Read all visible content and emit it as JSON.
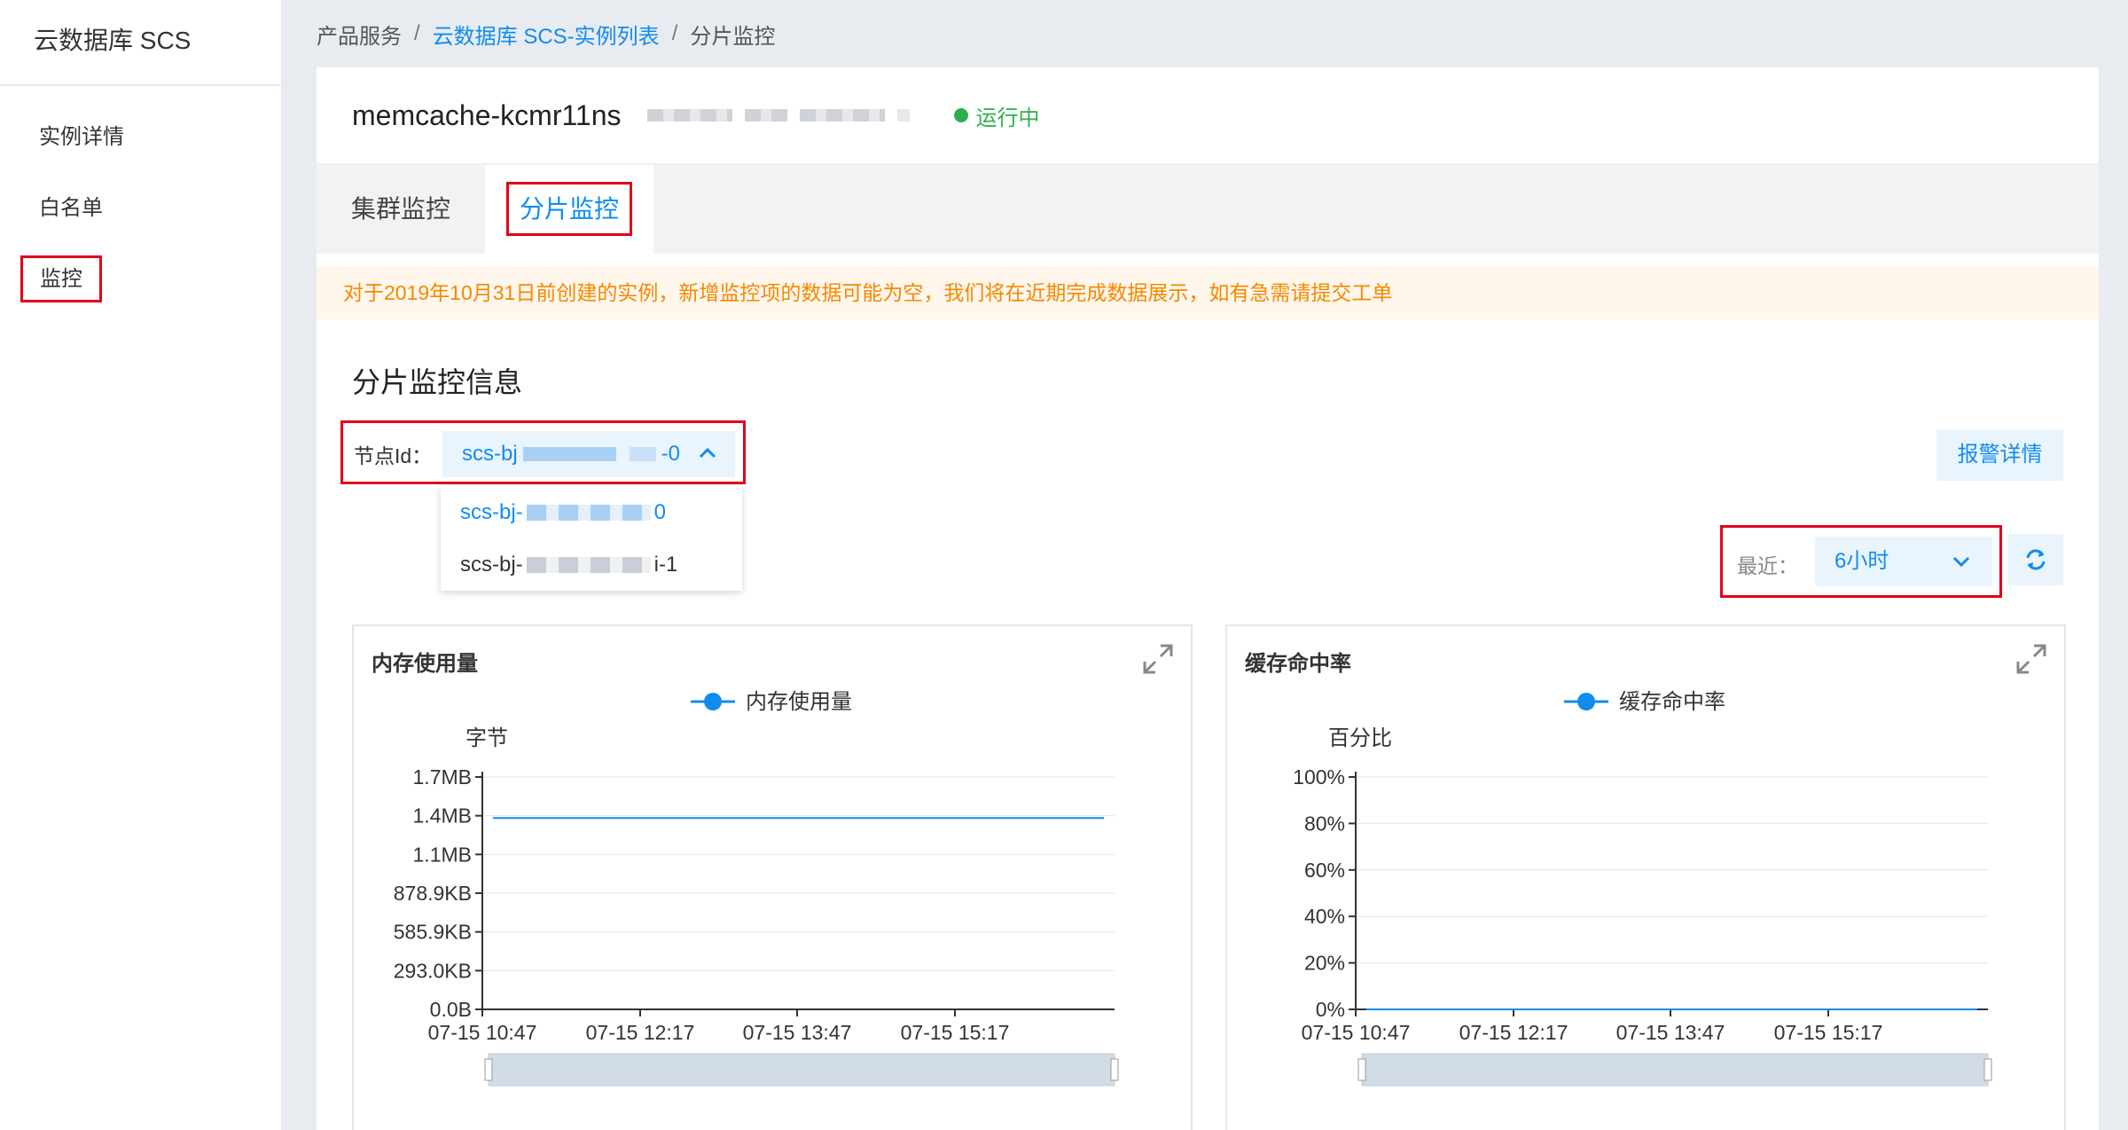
{
  "sidebar": {
    "title": "云数据库 SCS",
    "items": [
      {
        "label": "实例详情"
      },
      {
        "label": "白名单"
      },
      {
        "label": "监控"
      }
    ]
  },
  "breadcrumb": {
    "root": "产品服务",
    "link": "云数据库 SCS-实例列表",
    "current": "分片监控",
    "sep": "/"
  },
  "instance": {
    "name": "memcache-kcmr11ns",
    "status": "运行中"
  },
  "tabs": [
    {
      "label": "集群监控"
    },
    {
      "label": "分片监控"
    }
  ],
  "notice": "对于2019年10月31日前创建的实例，新增监控项的数据可能为空，我们将在近期完成数据展示，如有急需请提交工单",
  "section_title": "分片监控信息",
  "node": {
    "label": "节点Id：",
    "selected_prefix": "scs-bj",
    "selected_suffix": "-0",
    "options": [
      {
        "prefix": "scs-bj-",
        "suffix": "0"
      },
      {
        "prefix": "scs-bj-",
        "suffix": "i-1"
      }
    ]
  },
  "alarm_button": "报警详情",
  "recent": {
    "label": "最近：",
    "value": "6小时"
  },
  "colors": {
    "accent": "#108cee",
    "highlight": "#e0001b",
    "success": "#2cb04f",
    "warning": "#f38900"
  },
  "chart_data": [
    {
      "type": "line",
      "title": "内存使用量",
      "legend": "内存使用量",
      "unit_label": "字节",
      "yticks": [
        "0.0B",
        "293.0KB",
        "585.9KB",
        "878.9KB",
        "1.1MB",
        "1.4MB",
        "1.7MB"
      ],
      "ylim": [
        0,
        1.7
      ],
      "xticks": [
        "07-15 10:47",
        "07-15 12:17",
        "07-15 13:47",
        "07-15 15:17"
      ],
      "series": [
        {
          "name": "内存使用量",
          "values": [
            1.4,
            1.4
          ]
        }
      ]
    },
    {
      "type": "line",
      "title": "缓存命中率",
      "legend": "缓存命中率",
      "unit_label": "百分比",
      "yticks": [
        "0%",
        "20%",
        "40%",
        "60%",
        "80%",
        "100%"
      ],
      "ylim": [
        0,
        100
      ],
      "xticks": [
        "07-15 10:47",
        "07-15 12:17",
        "07-15 13:47",
        "07-15 15:17"
      ],
      "series": [
        {
          "name": "缓存命中率",
          "values": [
            0,
            0
          ]
        }
      ]
    }
  ]
}
